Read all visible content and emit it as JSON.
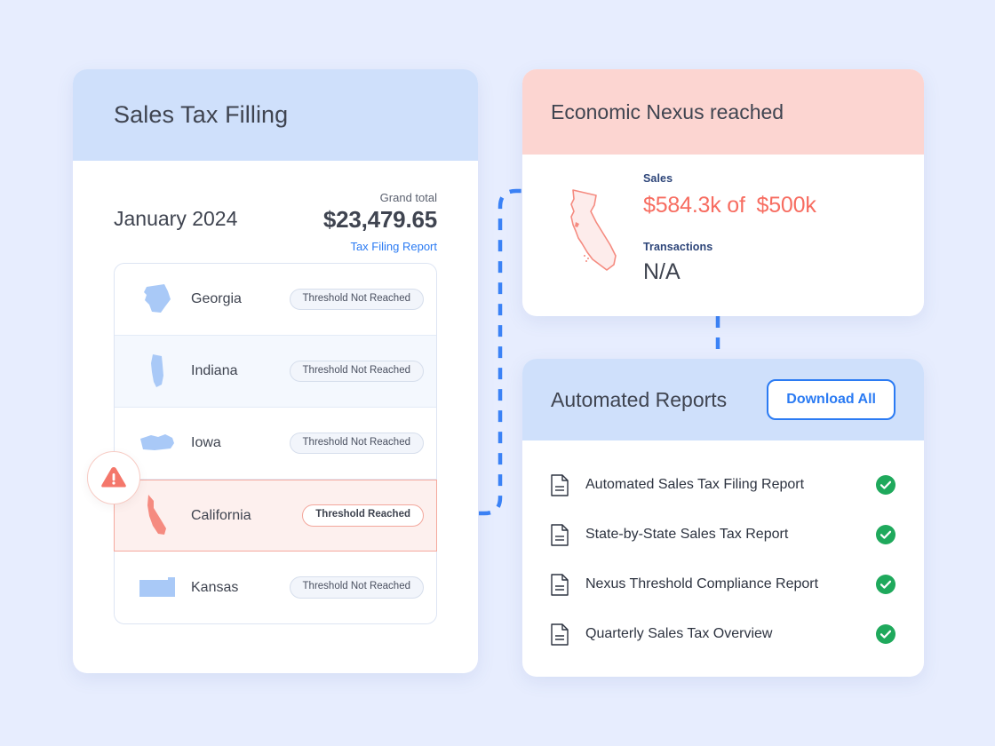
{
  "page": {
    "background_color": "#e7edfe"
  },
  "filing_card": {
    "title": "Sales Tax Filling",
    "header_color": "#cfe0fb",
    "period": "January 2024",
    "grand_total_label": "Grand total",
    "grand_total_amount": "$23,479.65",
    "report_link": "Tax Filing Report",
    "link_color": "#2b7bf3",
    "states": [
      {
        "name": "Georgia",
        "badge": "Threshold Not Reached",
        "status": "not-reached",
        "shape": "georgia-shape-icon",
        "tinted": false
      },
      {
        "name": "Indiana",
        "badge": "Threshold Not Reached",
        "status": "not-reached",
        "shape": "indiana-shape-icon",
        "tinted": true
      },
      {
        "name": "Iowa",
        "badge": "Threshold Not Reached",
        "status": "not-reached",
        "shape": "iowa-shape-icon",
        "tinted": false
      },
      {
        "name": "California",
        "badge": "Threshold Reached",
        "status": "reached",
        "shape": "california-shape-icon",
        "tinted": false
      },
      {
        "name": "Kansas",
        "badge": "Threshold Not Reached",
        "status": "not-reached",
        "shape": "kansas-shape-icon",
        "tinted": false
      }
    ],
    "alert_icon": "warning-triangle-icon",
    "alert_color": "#f4776b",
    "state_shape_color": "#a9c9f7",
    "alert_shape_color": "#f58b80"
  },
  "nexus_card": {
    "title": "Economic Nexus reached",
    "header_color": "#fcd5d1",
    "map_icon": "california-outline-icon",
    "sales_label": "Sales",
    "sales_value": "$584.3k of",
    "sales_threshold": "$500k",
    "sales_color": "#f76d61",
    "transactions_label": "Transactions",
    "transactions_value": "N/A"
  },
  "reports_card": {
    "title": "Automated Reports",
    "header_color": "#cfe0fb",
    "download_button": "Download All",
    "button_color": "#2b7bf3",
    "status_color": "#1fa95c",
    "items": [
      {
        "name": "Automated Sales Tax Filing Report",
        "icon": "document-icon",
        "status": "check-circle-icon"
      },
      {
        "name": "State-by-State Sales Tax Report",
        "icon": "document-icon",
        "status": "check-circle-icon"
      },
      {
        "name": "Nexus Threshold Compliance Report",
        "icon": "document-icon",
        "status": "check-circle-icon"
      },
      {
        "name": "Quarterly Sales Tax Overview",
        "icon": "document-icon",
        "status": "check-circle-icon"
      }
    ]
  },
  "connectors": {
    "color": "#3b82f6",
    "description": "dashed flow lines linking California row to Economic Nexus card and Economic Nexus card to Automated Reports card"
  }
}
